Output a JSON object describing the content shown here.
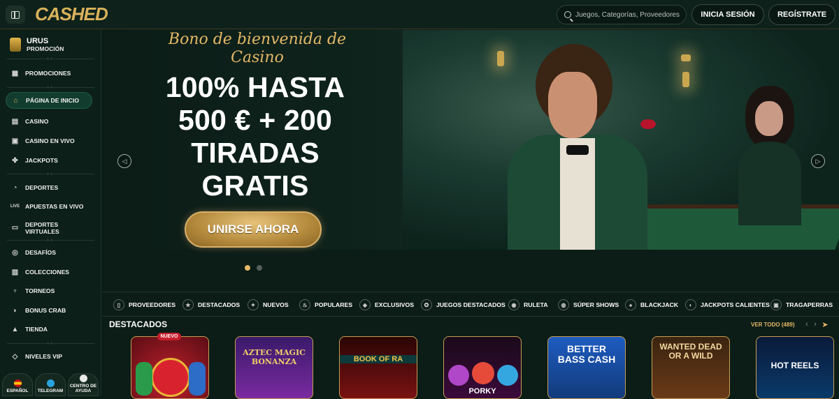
{
  "header": {
    "logo": "CASHED",
    "search_placeholder": "Juegos, Categorías, Proveedores",
    "login": "INICIA SESIÓN",
    "register": "REGÍSTRATE"
  },
  "sidebar": {
    "promo_title": "URUS",
    "promo_sub": "PROMOCIÓN",
    "items": [
      {
        "label": "PROMOCIONES",
        "icon": "gift-icon"
      },
      {
        "label": "PÁGINA DE INICIO",
        "icon": "home-icon"
      },
      {
        "label": "CASINO",
        "icon": "casino-icon"
      },
      {
        "label": "CASINO EN VIVO",
        "icon": "live-casino-icon"
      },
      {
        "label": "JACKPOTS",
        "icon": "clover-icon"
      },
      {
        "label": "DEPORTES",
        "icon": "sports-icon"
      },
      {
        "label": "APUESTAS EN VIVO",
        "icon": "live-icon"
      },
      {
        "label": "DEPORTES VIRTUALES",
        "icon": "virtual-icon"
      },
      {
        "label": "DESAFÍOS",
        "icon": "challenge-icon"
      },
      {
        "label": "COLECCIONES",
        "icon": "collection-icon"
      },
      {
        "label": "TORNEOS",
        "icon": "trophy-icon"
      },
      {
        "label": "BONUS CRAB",
        "icon": "crab-icon"
      },
      {
        "label": "TIENDA",
        "icon": "shop-icon"
      },
      {
        "label": "NIVELES VIP",
        "icon": "diamond-icon"
      }
    ],
    "bottom": [
      "ESPAÑOL",
      "TELEGRAM",
      "CENTRO DE AYUDA"
    ]
  },
  "hero": {
    "bono": "Bono de bienvenida de Casino",
    "offer": "100% HASTA 500 € + 200 TIRADAS GRATIS",
    "cta": "UNIRSE AHORA"
  },
  "categories": [
    "PROVEEDORES",
    "DESTACADOS",
    "NUEVOS",
    "POPULARES",
    "EXCLUSIVOS",
    "JUEGOS DESTACADOS",
    "RULETA",
    "SÚPER SHOWS",
    "BLACKJACK",
    "JACKPOTS CALIENTES",
    "TRAGAPERRAS"
  ],
  "featured": {
    "title": "DESTACADOS",
    "view_all": "VER TODO (489)",
    "new_badge": "NUEVO",
    "games": [
      "",
      "AZTEC MAGIC BONANZA",
      "BOOK OF RA",
      "PORKY",
      "BETTER BASS CASH",
      "WANTED DEAD OR A WILD",
      "HOT REELS"
    ]
  }
}
